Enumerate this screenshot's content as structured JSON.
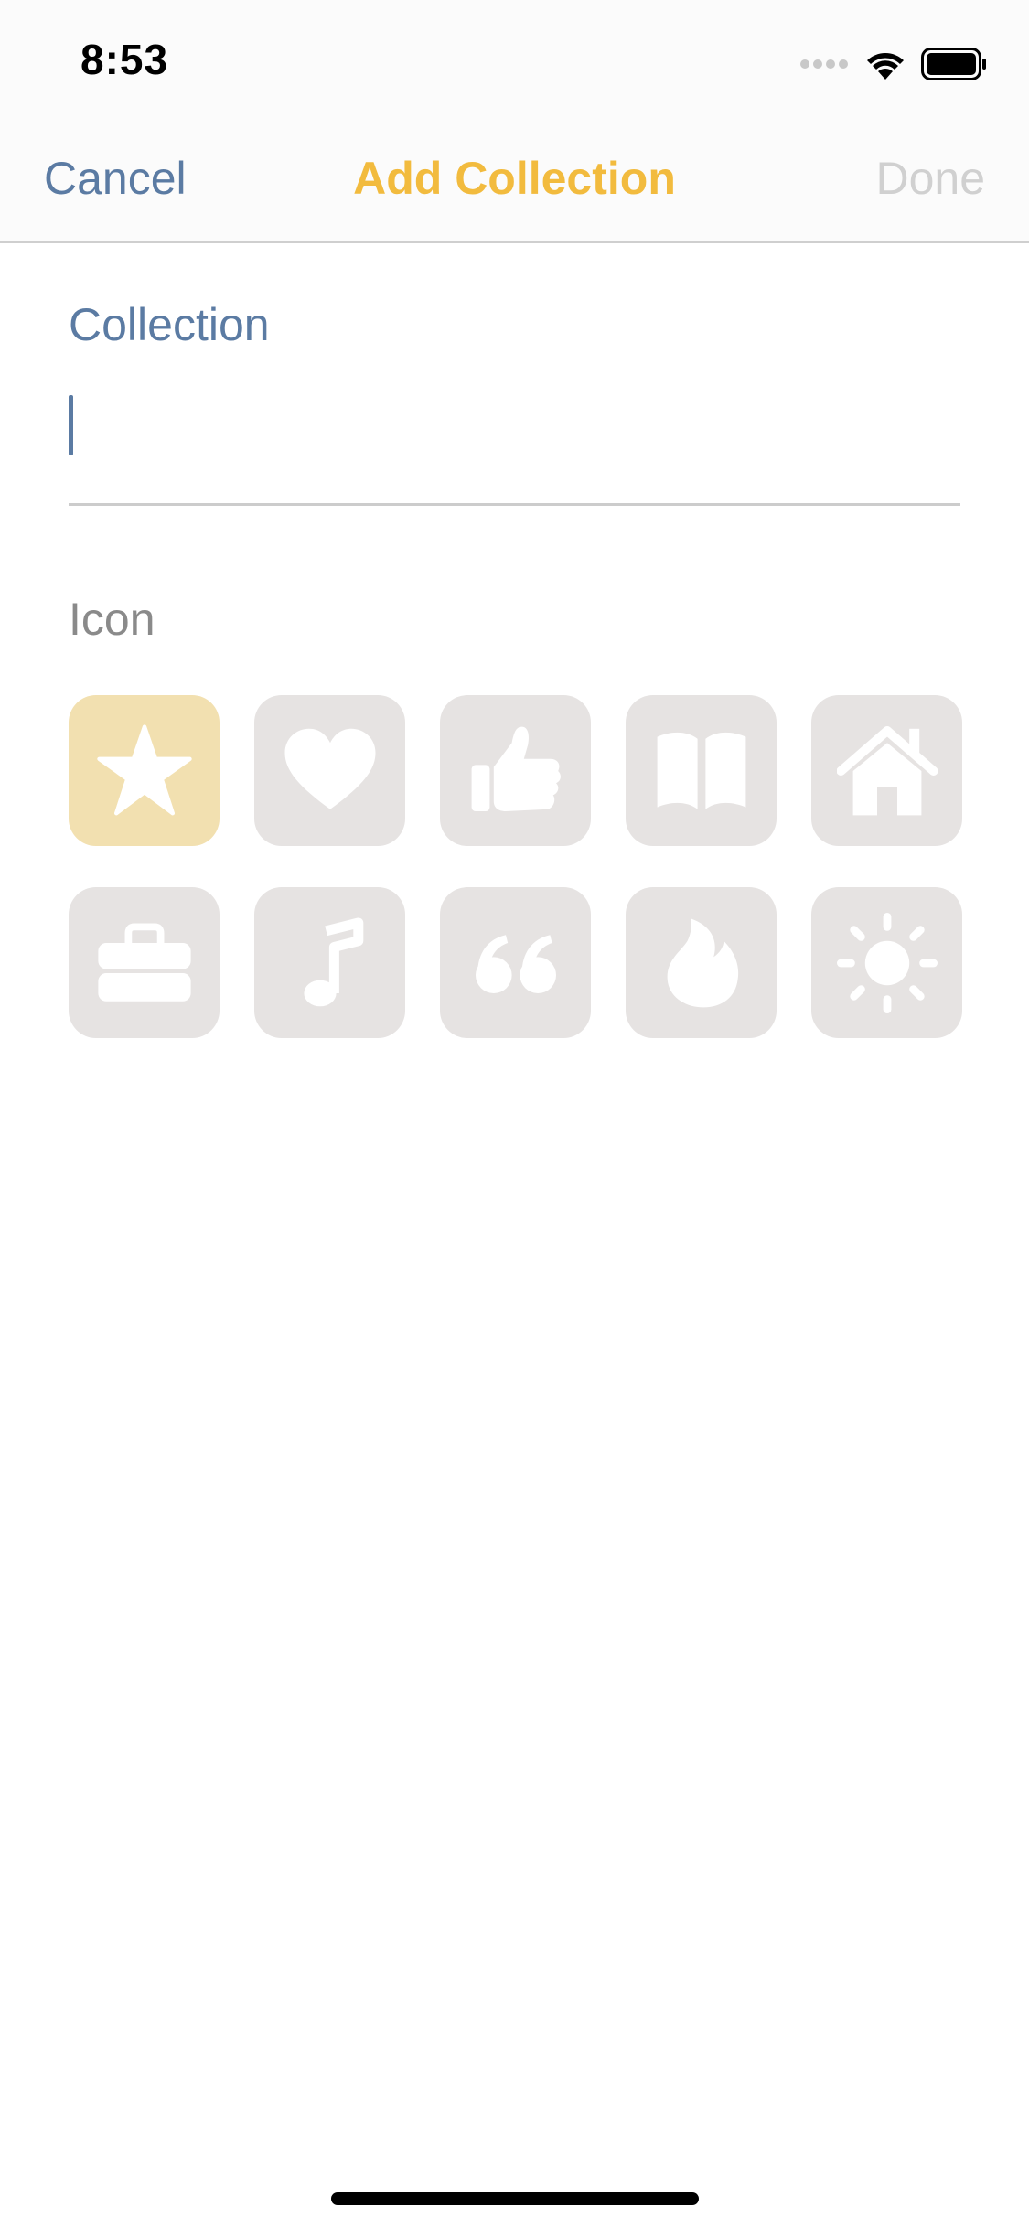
{
  "status_bar": {
    "time": "8:53"
  },
  "nav": {
    "cancel_label": "Cancel",
    "title": "Add Collection",
    "done_label": "Done"
  },
  "form": {
    "collection_label": "Collection",
    "collection_value": "",
    "icon_label": "Icon",
    "icons": [
      {
        "name": "star-icon",
        "selected": true
      },
      {
        "name": "heart-icon",
        "selected": false
      },
      {
        "name": "thumbs-up-icon",
        "selected": false
      },
      {
        "name": "book-icon",
        "selected": false
      },
      {
        "name": "house-icon",
        "selected": false
      },
      {
        "name": "toolbox-icon",
        "selected": false
      },
      {
        "name": "music-note-icon",
        "selected": false
      },
      {
        "name": "quote-icon",
        "selected": false
      },
      {
        "name": "flame-icon",
        "selected": false
      },
      {
        "name": "sun-icon",
        "selected": false
      }
    ]
  },
  "colors": {
    "accent_yellow": "#f2bb3e",
    "accent_blue": "#5b7ba3",
    "done_disabled": "#d0d0d0",
    "tile_default": "#e6e3e2",
    "tile_selected": "#f2e0b0"
  }
}
